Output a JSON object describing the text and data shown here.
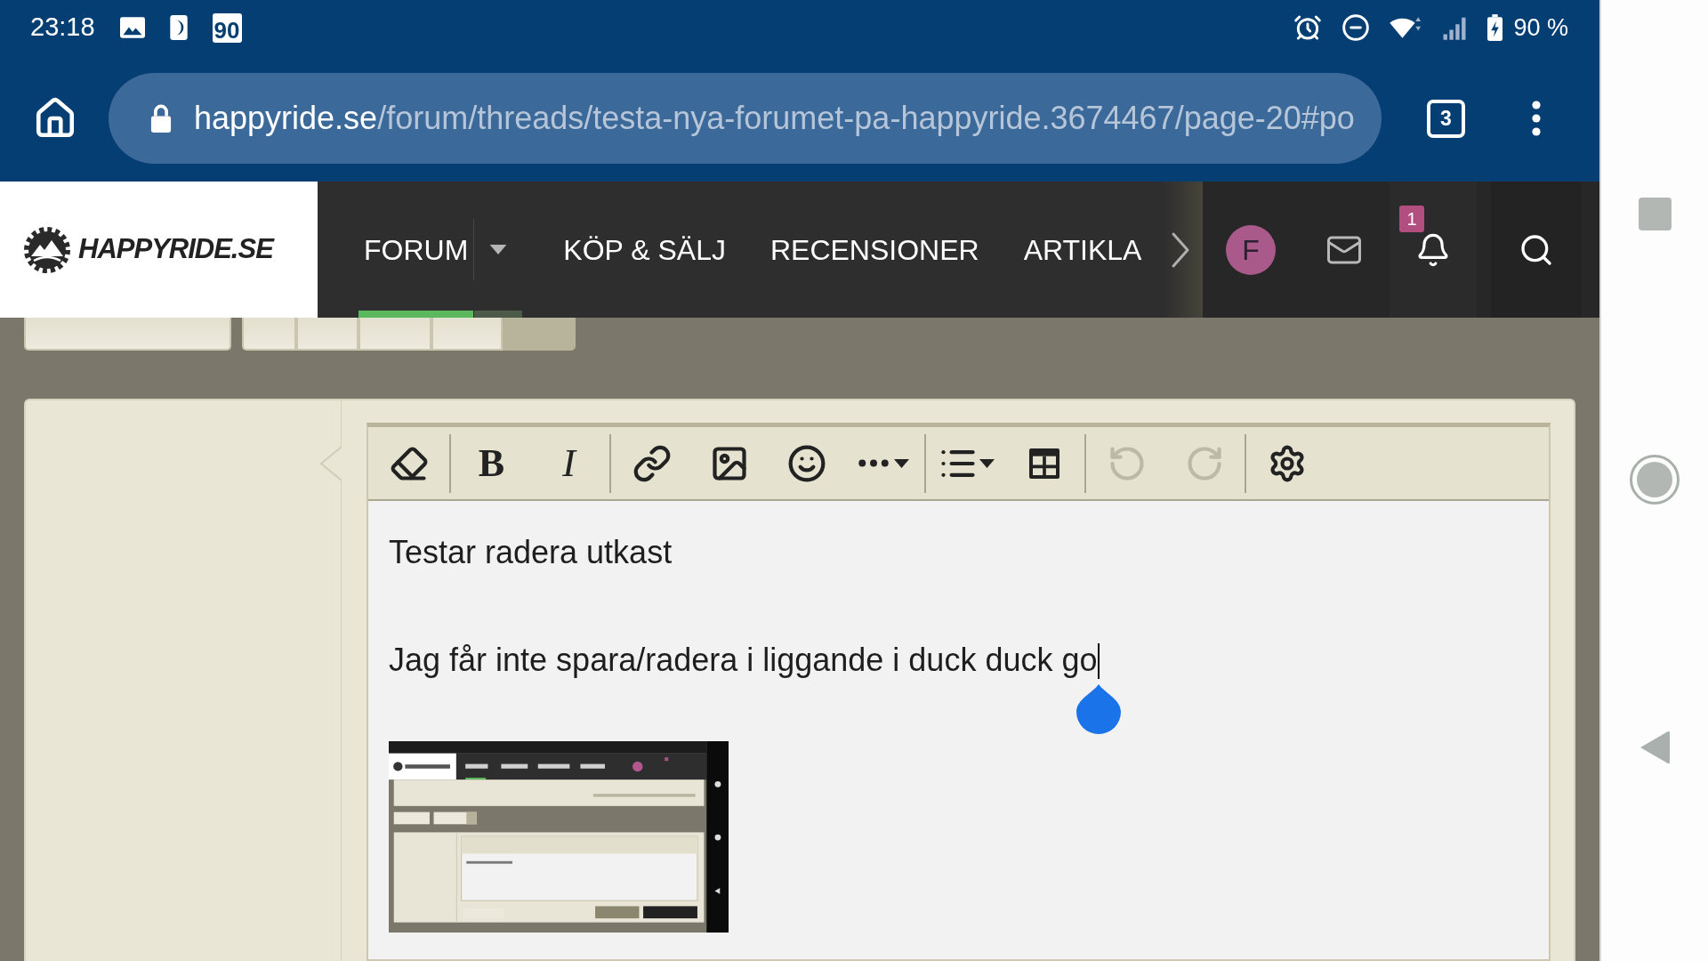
{
  "status_bar": {
    "time": "23:18",
    "app_icon_number": "90",
    "battery_text": "90 %"
  },
  "browser": {
    "url_domain": "happyride.se",
    "url_path": "/forum/threads/testa-nya-forumet-pa-happyride.3674467/page-20#po",
    "tab_count": "3"
  },
  "site_header": {
    "logo_text": "HAPPYRIDE.SE",
    "nav": [
      {
        "label": "FORUM",
        "selected": true,
        "has_menu": true
      },
      {
        "label": "KÖP & SÄLJ",
        "selected": false,
        "has_menu": false
      },
      {
        "label": "RECENSIONER",
        "selected": false,
        "has_menu": false
      },
      {
        "label": "ARTIKLA",
        "selected": false,
        "has_menu": false
      }
    ],
    "avatar_initial": "F",
    "alert_count": "1"
  },
  "pagination": {
    "pages": [
      {
        "selected": false
      },
      {
        "selected": false
      },
      {
        "selected": false
      },
      {
        "selected": false
      },
      {
        "selected": true
      }
    ]
  },
  "editor": {
    "toolbar": [
      {
        "buttons": [
          {
            "kind": "icon",
            "disabled": false
          }
        ]
      },
      {
        "buttons": [
          {
            "kind": "bold",
            "label": "B",
            "disabled": false
          },
          {
            "kind": "italic",
            "label": "I",
            "disabled": false
          }
        ]
      },
      {
        "buttons": [
          {
            "kind": "icon",
            "disabled": false
          },
          {
            "kind": "icon",
            "disabled": false
          },
          {
            "kind": "icon",
            "disabled": false
          },
          {
            "kind": "icon",
            "disabled": false
          }
        ]
      },
      {
        "buttons": [
          {
            "kind": "icon",
            "disabled": false
          },
          {
            "kind": "icon",
            "disabled": false
          }
        ]
      },
      {
        "buttons": [
          {
            "kind": "icon",
            "disabled": true
          },
          {
            "kind": "icon",
            "disabled": true
          }
        ]
      },
      {
        "buttons": [
          {
            "kind": "icon",
            "disabled": false
          }
        ]
      }
    ],
    "paragraphs": [
      {
        "text": "Testar radera utkast",
        "has_cursor": false
      },
      {
        "text": "Jag får inte spara/radera i liggande i duck duck go",
        "has_cursor": true
      }
    ]
  }
}
